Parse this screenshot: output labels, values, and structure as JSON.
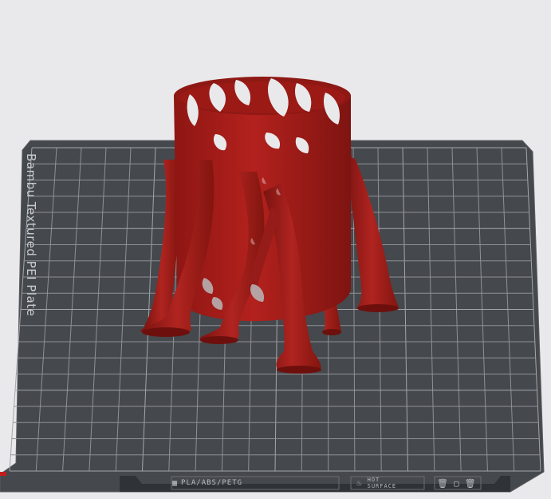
{
  "scene": {
    "plate": {
      "label": "Bambu Textured PEI Plate",
      "material_strip": "PLA/ABS/PETG",
      "hot_surface_line1": "HOT",
      "hot_surface_line2": "SURFACE",
      "plate_color": "#45484d",
      "grid_color": "#8d9095",
      "model_color": "#a01d1a"
    },
    "model": {
      "description_icon": "vase-with-tree-supports"
    }
  }
}
